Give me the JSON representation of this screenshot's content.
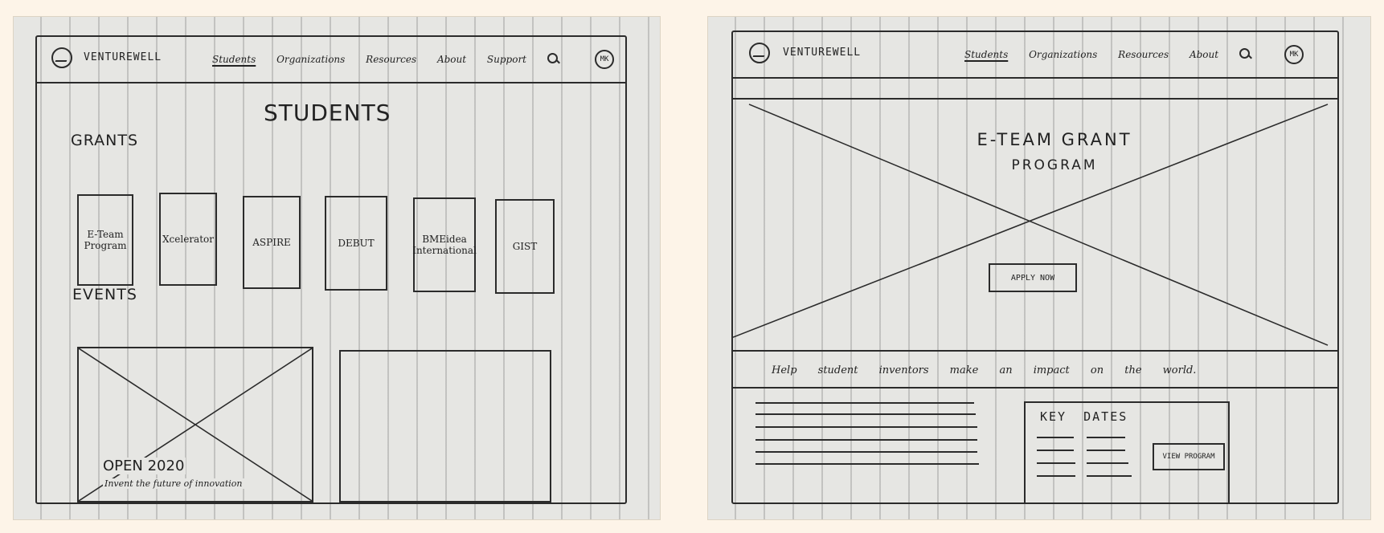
{
  "brand": "VENTUREWELL",
  "avatar": "MK",
  "nav_left": [
    "Students",
    "Organizations",
    "Resources",
    "About",
    "Support"
  ],
  "nav_right": [
    "Students",
    "Organizations",
    "Resources",
    "About"
  ],
  "left": {
    "title": "STUDENTS",
    "grants_heading": "GRANTS",
    "grants": [
      "E-Team Program",
      "Xcelerator",
      "ASPIRE",
      "DEBUT",
      "BMEidea International",
      "GIST"
    ],
    "events_heading": "EVENTS",
    "event_title": "OPEN 2020",
    "event_subtitle": "Invent the future of innovation"
  },
  "right": {
    "hero_title_line1": "E-TEAM GRANT",
    "hero_title_line2": "PROGRAM",
    "apply_button": "APPLY NOW",
    "tagline": "Help student inventors make an impact on the world.",
    "key_dates_heading": "KEY DATES",
    "view_program_button": "VIEW PROGRAM"
  }
}
